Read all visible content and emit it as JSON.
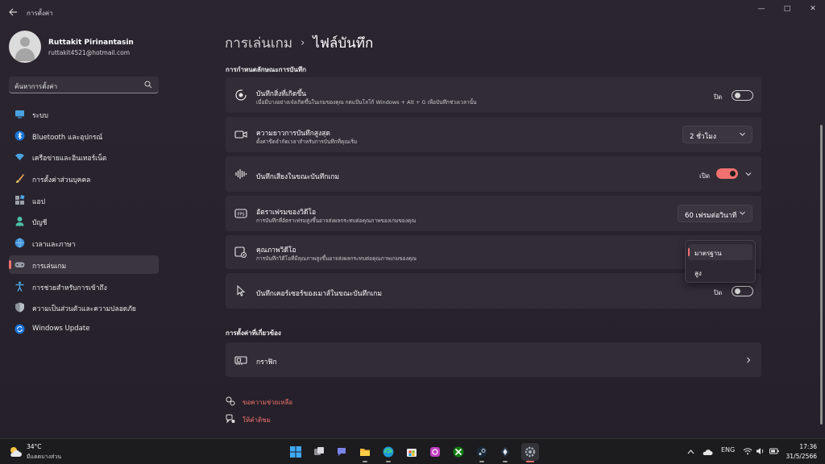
{
  "window": {
    "title": "การตั้งค่า",
    "minimize": "—",
    "maximize": "□",
    "close": "✕"
  },
  "profile": {
    "name": "Ruttakit Pirinantasin",
    "email": "ruttakit4521@hotmail.com"
  },
  "search": {
    "placeholder": "ค้นหาการตั้งค่า"
  },
  "sidebar": {
    "items": [
      {
        "label": "ระบบ",
        "icon": "monitor-icon",
        "active": false
      },
      {
        "label": "Bluetooth และอุปกรณ์",
        "icon": "bluetooth-icon",
        "active": false
      },
      {
        "label": "เครือข่ายและอินเทอร์เน็ต",
        "icon": "wifi-icon",
        "active": false
      },
      {
        "label": "การตั้งค่าส่วนบุคคล",
        "icon": "brush-icon",
        "active": false
      },
      {
        "label": "แอป",
        "icon": "apps-icon",
        "active": false
      },
      {
        "label": "บัญชี",
        "icon": "person-icon",
        "active": false
      },
      {
        "label": "เวลาและภาษา",
        "icon": "globe-clock-icon",
        "active": false
      },
      {
        "label": "การเล่นเกม",
        "icon": "gamepad-icon",
        "active": true
      },
      {
        "label": "การช่วยสำหรับการเข้าถึง",
        "icon": "accessibility-icon",
        "active": false
      },
      {
        "label": "ความเป็นส่วนตัวและความปลอดภัย",
        "icon": "shield-icon",
        "active": false
      },
      {
        "label": "Windows Update",
        "icon": "update-icon",
        "active": false
      }
    ]
  },
  "breadcrumb": {
    "parent": "การเล่นเกม",
    "separator": "›",
    "current": "ไฟล์บันทึก"
  },
  "sections": {
    "recording": "การกำหนดลักษณะการบันทึก",
    "related": "การตั้งค่าที่เกี่ยวข้อง"
  },
  "settings": {
    "record_what_happened": {
      "title": "บันทึกสิ่งที่เกิดขึ้น",
      "desc": "เมื่อมีบางอย่างเจ๋งเกิดขึ้นในเกมของคุณ กดแป้นโลโก้ Windows + Alt + G เพื่อบันทึกช่วงเวลานั้น",
      "state": "ปิด",
      "on": false
    },
    "max_length": {
      "title": "ความยาวการบันทึกสูงสุด",
      "desc": "ตั้งค่าขีดจำกัดเวลาสำหรับการบันทึกที่คุณเริ่ม",
      "value": "2 ชั่วโมง"
    },
    "record_audio": {
      "title": "บันทึกเสียงในขณะบันทึกเกม",
      "state": "เปิด",
      "on": true
    },
    "frame_rate": {
      "title": "อัตราเฟรมของวิดีโอ",
      "desc": "การบันทึกที่อัตราเฟรมสูงขึ้นอาจส่งผลกระทบต่อคุณภาพของเกมของคุณ",
      "value": "60 เฟรมต่อวินาที"
    },
    "video_quality": {
      "title": "คุณภาพวิดีโอ",
      "desc": "การบันทึกวิดีโอที่มีคุณภาพสูงขึ้นอาจส่งผลกระทบต่อคุณภาพเกมของคุณ",
      "options": [
        "มาตรฐาน",
        "สูง"
      ],
      "selected": "มาตรฐาน"
    },
    "record_cursor": {
      "title": "บันทึกเคอร์เซอร์ของเมาส์ในขณะบันทึกเกม",
      "state": "ปิด",
      "on": false
    },
    "graphics": {
      "title": "กราฟิก"
    }
  },
  "links": {
    "help": "ขอความช่วยเหลือ",
    "feedback": "ให้คำติชม"
  },
  "taskbar": {
    "weather": {
      "temp": "34°C",
      "desc": "มีแดดบางส่วน"
    },
    "apps": [
      "start-icon",
      "task-view-icon",
      "teams-chat-icon",
      "file-explorer-icon",
      "edge-icon",
      "store-icon",
      "app-icon",
      "xbox-icon",
      "steam-icon",
      "game-icon",
      "settings-icon"
    ],
    "tray": {
      "language": "ENG"
    },
    "clock": {
      "time": "17:36",
      "date": "31/5/2566"
    }
  },
  "colors": {
    "accent": "#f0716f",
    "background": "#27222c",
    "card": "#322c37"
  }
}
